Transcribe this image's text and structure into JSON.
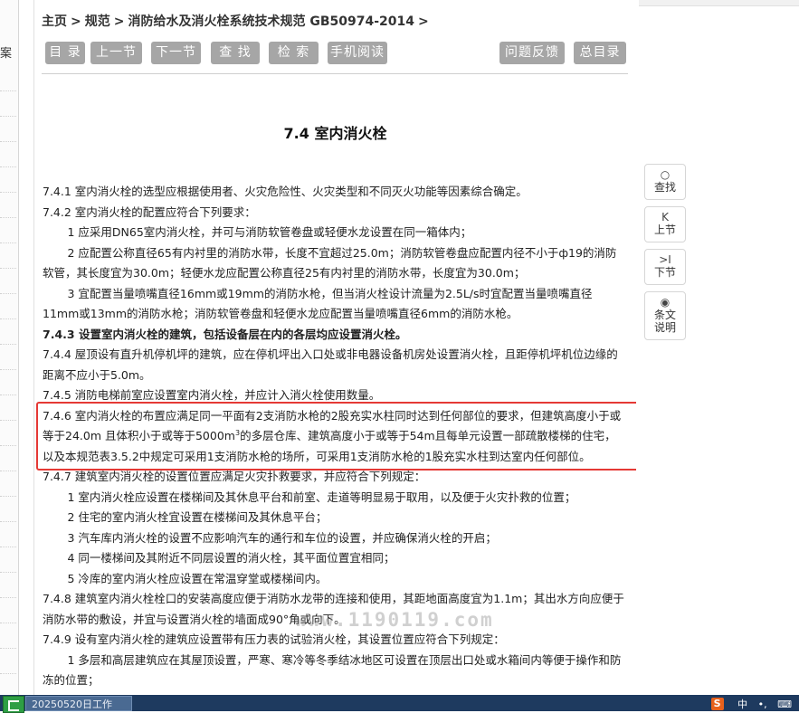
{
  "breadcrumb": {
    "home": "主页",
    "sep": ">",
    "spec": "规范",
    "current": "消防给水及消火栓系统技术规范 GB50974-2014",
    "end": ">"
  },
  "left_strip": {
    "fragment": "案"
  },
  "toolbar": {
    "contents": "目 录",
    "prev_section": "上一节",
    "next_section": "下一节",
    "find": "查 找",
    "search": "检 索",
    "mobile": "手机阅读",
    "feedback": "问题反馈",
    "master_contents": "总目录"
  },
  "title": "7.4 室内消火栓",
  "content": {
    "l1": "7.4.1 室内消火栓的选型应根据使用者、火灾危险性、火灾类型和不同灭火功能等因素综合确定。",
    "l2": "7.4.2 室内消火栓的配置应符合下列要求：",
    "l3": "1 应采用DN65室内消火栓，并可与消防软管卷盘或轻便水龙设置在同一箱体内；",
    "l4": "2 应配置公称直径65有内衬里的消防水带，长度不宜超过25.0m；消防软管卷盘应配置内径不小于ф19的消防软管，其长度宜为30.0m；轻便水龙应配置公称直径25有内衬里的消防水带，长度宜为30.0m；",
    "l5": "3 宜配置当量喷嘴直径16mm或19mm的消防水枪，但当消火栓设计流量为2.5L/s时宜配置当量喷嘴直径11mm或13mm的消防水枪；消防软管卷盘和轻便水龙应配置当量喷嘴直径6mm的消防水枪。",
    "l6": "7.4.3 设置室内消火栓的建筑，包括设备层在内的各层均应设置消火栓。",
    "l7": "7.4.4 屋顶设有直升机停机坪的建筑，应在停机坪出入口处或非电器设备机房处设置消火栓，且距停机坪机位边缘的距离不应小于5.0m。",
    "l8": "7.4.5 消防电梯前室应设置室内消火栓，并应计入消火栓使用数量。",
    "l9_a": "7.4.6 室内消火栓的布置应满足同一平面有2支消防水枪的2股充实水柱同时达到任何部位的要求，但建筑高度小于或等于24.0m 且体积小于或等于5000m",
    "l9_sup": "3",
    "l9_b": "的多层仓库、建筑高度小于或等于54m且每单元设置一部疏散楼梯的住宅，以及本规范表3.5.2中规定可采用1支消防水枪的场所，可采用1支消防水枪的1股充实水柱到达室内任何部位。",
    "l10": "7.4.7 建筑室内消火栓的设置位置应满足火灾扑救要求，并应符合下列规定：",
    "l11": "1 室内消火栓应设置在楼梯间及其休息平台和前室、走道等明显易于取用，以及便于火灾扑救的位置；",
    "l12": "2 住宅的室内消火栓宜设置在楼梯间及其休息平台；",
    "l13": "3 汽车库内消火栓的设置不应影响汽车的通行和车位的设置，并应确保消火栓的开启；",
    "l14": "4 同一楼梯间及其附近不同层设置的消火栓，其平面位置宜相同；",
    "l15": "5 冷库的室内消火栓应设置在常温穿堂或楼梯间内。",
    "l16": "7.4.8 建筑室内消火栓栓口的安装高度应便于消防水龙带的连接和使用，其距地面高度宜为1.1m；其出水方向应便于消防水带的敷设，并宜与设置消火栓的墙面成90°角或向下。",
    "l17": "7.4.9 设有室内消火栓的建筑应设置带有压力表的试验消火栓，其设置位置应符合下列规定：",
    "l18": "1 多层和高层建筑应在其屋顶设置，严寒、寒冷等冬季结冰地区可设置在顶层出口处或水箱间内等便于操作和防冻的位置；"
  },
  "watermark": "www.1190119.com",
  "sidebar": {
    "find": {
      "icon": "○",
      "label": "查找"
    },
    "prev": {
      "icon": "K",
      "label": "上节"
    },
    "next": {
      "icon": ">I",
      "label": "下节"
    },
    "notes": {
      "icon": "◉",
      "label1": "条文",
      "label2": "说明"
    }
  },
  "taskbar": {
    "item": "20250520日工作",
    "tray_s": "S",
    "tray_t1": "中",
    "tray_t2": "•,",
    "tray_t3": "⌨"
  },
  "colors": {
    "button_bg": "#a6a6a6",
    "highlight": "#e53935",
    "taskbar": "#1e3a5f"
  }
}
